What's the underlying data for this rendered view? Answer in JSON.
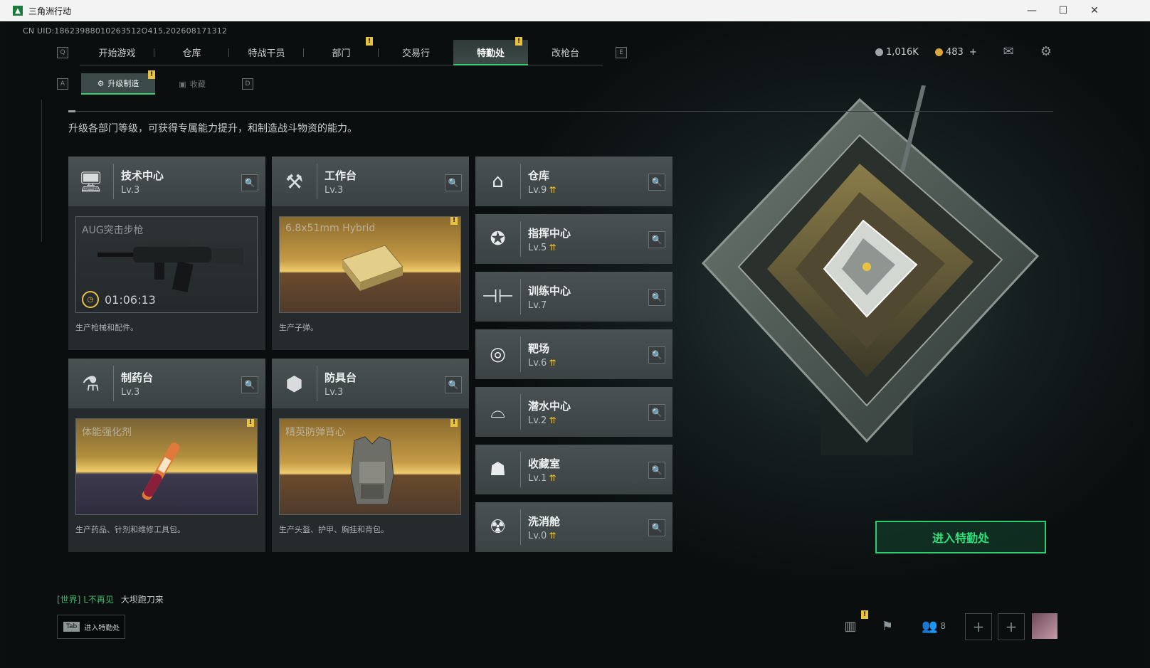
{
  "window": {
    "title": "三角洲行动",
    "minimize": "—",
    "maximize": "☐",
    "close": "✕"
  },
  "uid": "CN UID:18623988010263512O415,202608171312",
  "topnav": {
    "key_left": "Q",
    "key_right": "E",
    "tabs": [
      {
        "label": "开始游戏"
      },
      {
        "label": "仓库"
      },
      {
        "label": "特战干员"
      },
      {
        "label": "部门",
        "badge": "!"
      },
      {
        "label": "交易行"
      },
      {
        "label": "特勤处",
        "badge": "!"
      },
      {
        "label": "改枪台"
      }
    ]
  },
  "currency": {
    "silver": "1,016K",
    "gold": "483",
    "gold_add": "+"
  },
  "subnav": {
    "key_left": "A",
    "key_right": "D",
    "tabs": [
      {
        "label": "升级制造",
        "badge": "!"
      },
      {
        "label": "收藏"
      }
    ]
  },
  "description": "升级各部门等级，可获得专属能力提升，和制造战斗物资的能力。",
  "production_cards": [
    {
      "name": "技术中心",
      "level": "Lv.3",
      "item": "AUG突击步枪",
      "timer": "01:06:13",
      "footer": "生产枪械和配件。",
      "icon": "monitor-icon"
    },
    {
      "name": "工作台",
      "level": "Lv.3",
      "item": "6.8x51mm Hybrid",
      "badge": "!",
      "footer": "生产子弹。",
      "icon": "hammer-icon"
    },
    {
      "name": "制药台",
      "level": "Lv.3",
      "item": "体能强化剂",
      "badge": "!",
      "footer": "生产药品、针剂和维修工具包。",
      "icon": "flask-icon"
    },
    {
      "name": "防具台",
      "level": "Lv.3",
      "item": "精英防弹背心",
      "badge": "!",
      "footer": "生产头盔、护甲、胸挂和背包。",
      "icon": "cubes-icon"
    }
  ],
  "departments": [
    {
      "name": "仓库",
      "level": "Lv.9",
      "upgrade": true,
      "icon": "warehouse-icon"
    },
    {
      "name": "指挥中心",
      "level": "Lv.5",
      "upgrade": true,
      "icon": "command-icon"
    },
    {
      "name": "训练中心",
      "level": "Lv.7",
      "upgrade": false,
      "icon": "dumbbell-icon"
    },
    {
      "name": "靶场",
      "level": "Lv.6",
      "upgrade": true,
      "icon": "target-icon"
    },
    {
      "name": "潜水中心",
      "level": "Lv.2",
      "upgrade": true,
      "icon": "diving-mask-icon"
    },
    {
      "name": "收藏室",
      "level": "Lv.1",
      "upgrade": true,
      "icon": "collection-icon"
    },
    {
      "name": "洗消舱",
      "level": "Lv.0",
      "upgrade": true,
      "icon": "decon-icon"
    }
  ],
  "enter_button": "进入特勤处",
  "chat": {
    "channel": "[世界]",
    "user": "L不再见",
    "message": "大坝跑刀来"
  },
  "tab_hint": {
    "key": "Tab",
    "label": "进入特勤处"
  },
  "social": {
    "friends_count": "8",
    "badge": "!"
  },
  "colors": {
    "accent": "#2ecc71",
    "badge": "#e8c341",
    "panel": "#3f4648"
  }
}
